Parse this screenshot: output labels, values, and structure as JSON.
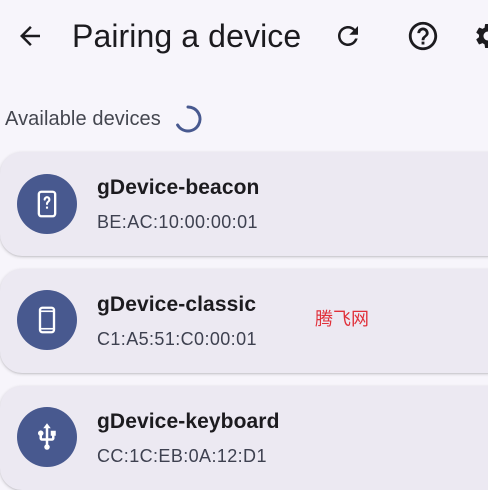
{
  "header": {
    "title": "Pairing a device",
    "back_icon": "arrow-back-icon",
    "refresh_icon": "refresh-icon",
    "help_icon": "help-icon",
    "settings_icon": "settings-icon"
  },
  "section": {
    "label": "Available devices",
    "spinner_icon": "progress-spinner-icon"
  },
  "devices": [
    {
      "name": "gDevice-beacon",
      "address": "BE:AC:10:00:00:01",
      "icon": "phone-unknown-icon"
    },
    {
      "name": "gDevice-classic",
      "address": "C1:A5:51:C0:00:01",
      "icon": "smartphone-icon"
    },
    {
      "name": "gDevice-keyboard",
      "address": "CC:1C:EB:0A:12:D1",
      "icon": "usb-icon"
    }
  ],
  "watermark": "腾飞网",
  "colors": {
    "background": "#f7f5fb",
    "card": "#ece9f2",
    "avatar": "#48598f",
    "accent": "#48598f",
    "watermark": "#e0303a"
  }
}
